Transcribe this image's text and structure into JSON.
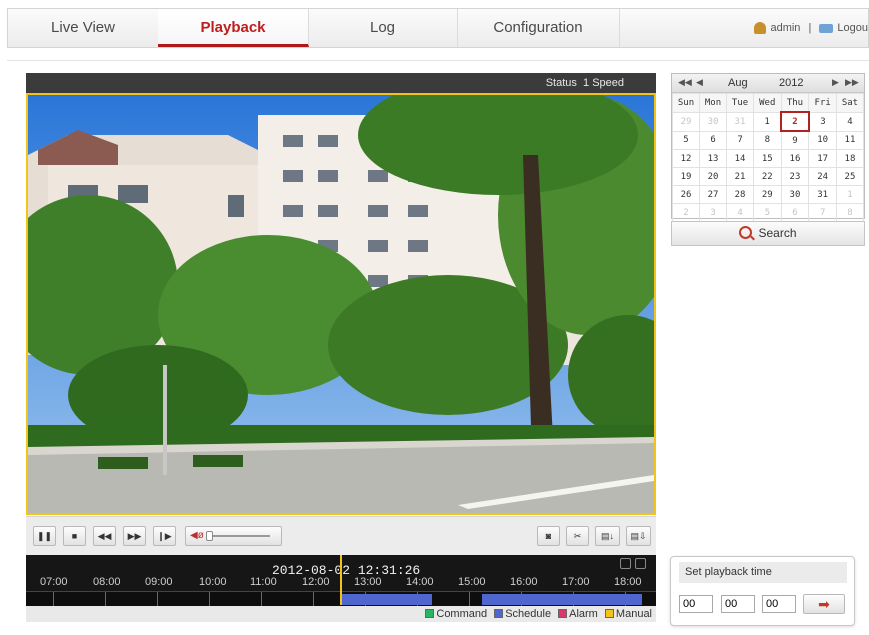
{
  "nav": {
    "tabs": [
      {
        "label": "Live View"
      },
      {
        "label": "Playback"
      },
      {
        "label": "Log"
      },
      {
        "label": "Configuration"
      }
    ],
    "user": "admin",
    "separator": "|",
    "logout": "Logou"
  },
  "player": {
    "status": "Status",
    "speed": "1 Speed",
    "datetime": "2012-08-02 12:31:26",
    "hours": [
      "07:00",
      "08:00",
      "09:00",
      "10:00",
      "11:00",
      "12:00",
      "13:00",
      "14:00",
      "15:00",
      "16:00",
      "17:00",
      "18:00"
    ],
    "legend": [
      {
        "label": "Command",
        "color": "#28b463"
      },
      {
        "label": "Schedule",
        "color": "#4f66cf"
      },
      {
        "label": "Alarm",
        "color": "#d9366b"
      },
      {
        "label": "Manual",
        "color": "#f0c419"
      }
    ]
  },
  "calendar": {
    "month": "Aug",
    "year": "2012",
    "weekdays": [
      "Sun",
      "Mon",
      "Tue",
      "Wed",
      "Thu",
      "Fri",
      "Sat"
    ],
    "weeks": [
      [
        "29",
        "30",
        "31",
        "1",
        "2",
        "3",
        "4"
      ],
      [
        "5",
        "6",
        "7",
        "8",
        "9",
        "10",
        "11"
      ],
      [
        "12",
        "13",
        "14",
        "15",
        "16",
        "17",
        "18"
      ],
      [
        "19",
        "20",
        "21",
        "22",
        "23",
        "24",
        "25"
      ],
      [
        "26",
        "27",
        "28",
        "29",
        "30",
        "31",
        "1"
      ],
      [
        "2",
        "3",
        "4",
        "5",
        "6",
        "7",
        "8"
      ]
    ],
    "selected": "2"
  },
  "search": {
    "label": "Search"
  },
  "playback_time": {
    "title": "Set playback time",
    "hour": "00",
    "minute": "00",
    "second": "00"
  },
  "colors": {
    "accent": "#b11818",
    "frame": "#f0c419",
    "schedule": "#4f66cf"
  }
}
